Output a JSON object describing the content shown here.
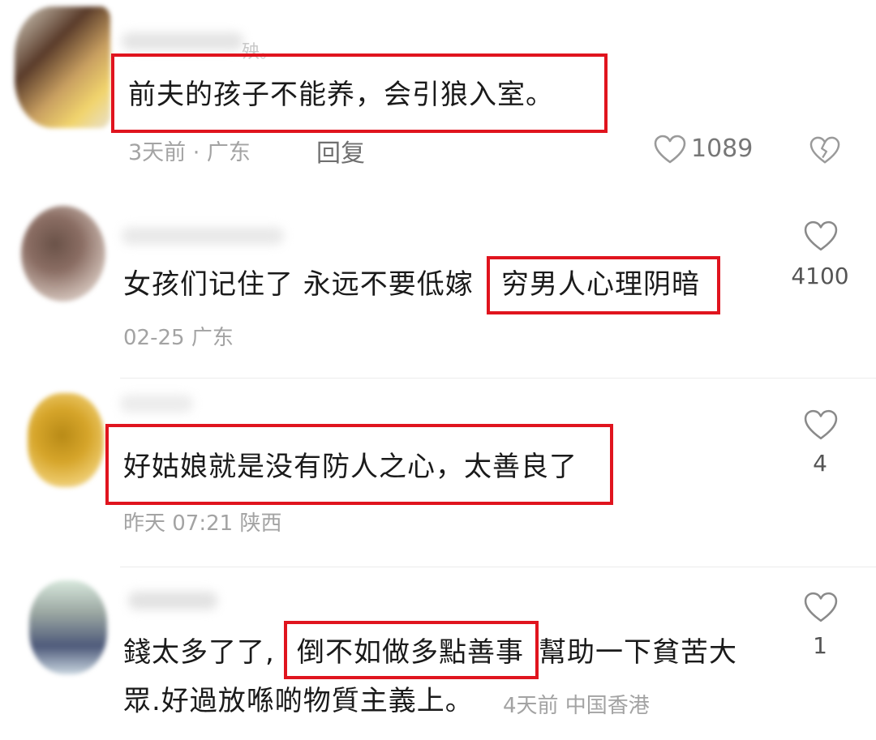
{
  "comments": [
    {
      "name_suffix": "殃。",
      "text": "前夫的孩子不能养，会引狼入室。",
      "meta": "3天前 · 广东",
      "reply_label": "回复",
      "likes": "1089"
    },
    {
      "text_before": "女孩们记住了 永远不要低嫁",
      "text_highlight": "穷男人心理阴暗",
      "meta": "02-25 广东",
      "likes": "4100"
    },
    {
      "text": "好姑娘就是没有防人之心，太善良了",
      "meta": "昨天 07:21 陕西",
      "likes": "4"
    },
    {
      "text_before": "錢太多了了,",
      "text_highlight": "倒不如做多點善事",
      "text_after": "幫助一下貧苦大",
      "text_line2": "眾.好過放喺啲物質主義上。",
      "meta": "4天前 中国香港",
      "likes": "1"
    }
  ],
  "colors": {
    "highlight_border": "#e0141e",
    "meta_text": "#a3a3a3"
  },
  "icons": {
    "like": "heart-outline-icon",
    "dislike": "broken-heart-icon"
  }
}
